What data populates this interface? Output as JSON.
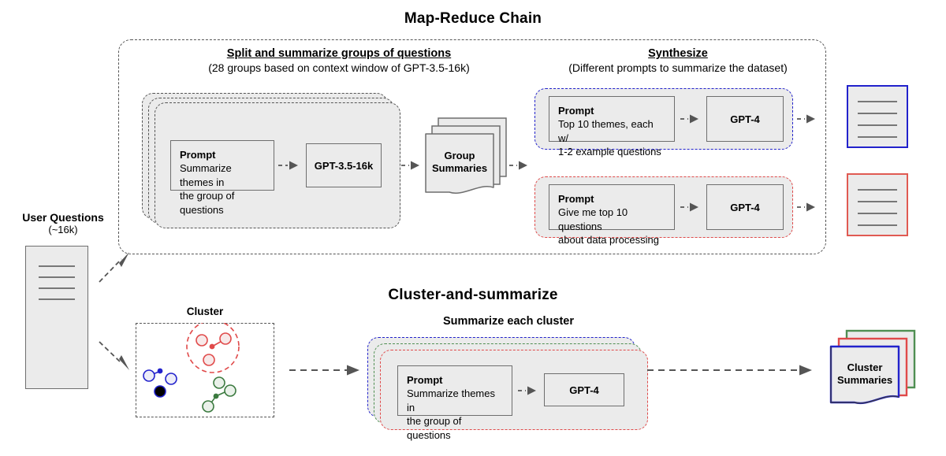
{
  "diagram": {
    "title_top": "Map-Reduce Chain",
    "title_bottom": "Cluster-and-summarize"
  },
  "map_reduce": {
    "split": {
      "title": "Split and summarize groups of questions",
      "subtitle": "(28 groups based on context window of GPT-3.5-16k)",
      "prompt_title": "Prompt",
      "prompt_body_line1": "Summarize themes in",
      "prompt_body_line2": "the group of questions",
      "model": "GPT-3.5-16k"
    },
    "group_summaries": "Group\nSummaries",
    "group_summaries_line1": "Group",
    "group_summaries_line2": "Summaries",
    "synthesize": {
      "title": "Synthesize",
      "subtitle": "(Different prompts to summarize the dataset)",
      "branches": [
        {
          "accent": "#2222cc",
          "prompt_title": "Prompt",
          "prompt_body_line1": "Top 10 themes, each w/",
          "prompt_body_line2": "1-2 example questions",
          "model": "GPT-4"
        },
        {
          "accent": "#e04a4a",
          "prompt_title": "Prompt",
          "prompt_body_line1": "Give me top 10 questions",
          "prompt_body_line2": "about data processing",
          "model": "GPT-4"
        }
      ]
    },
    "outputs": [
      {
        "accent": "#2222cc",
        "lines": 4
      },
      {
        "accent": "#e05a52",
        "lines": 4
      }
    ]
  },
  "user_questions": {
    "label_line1": "User Questions",
    "label_line2": "(~16k)",
    "doc_lines": 4
  },
  "cluster": {
    "title": "Cluster",
    "groups": [
      {
        "color": "#2222cc",
        "name": "blue-cluster"
      },
      {
        "color": "#e04a4a",
        "name": "red-cluster"
      },
      {
        "color": "#3b7a3f",
        "name": "green-cluster"
      }
    ]
  },
  "summarize_cluster": {
    "title": "Summarize each cluster",
    "stack_accents": [
      "#2222cc",
      "#4f8f52",
      "#e04a4a"
    ],
    "prompt_title": "Prompt",
    "prompt_body_line1": "Summarize themes in",
    "prompt_body_line2": "the group of questions",
    "model": "GPT-4"
  },
  "cluster_summaries": {
    "line1": "Cluster",
    "line2": "Summaries",
    "stack_accents": [
      "#4f8f52",
      "#e04a4a",
      "#2222cc"
    ]
  }
}
